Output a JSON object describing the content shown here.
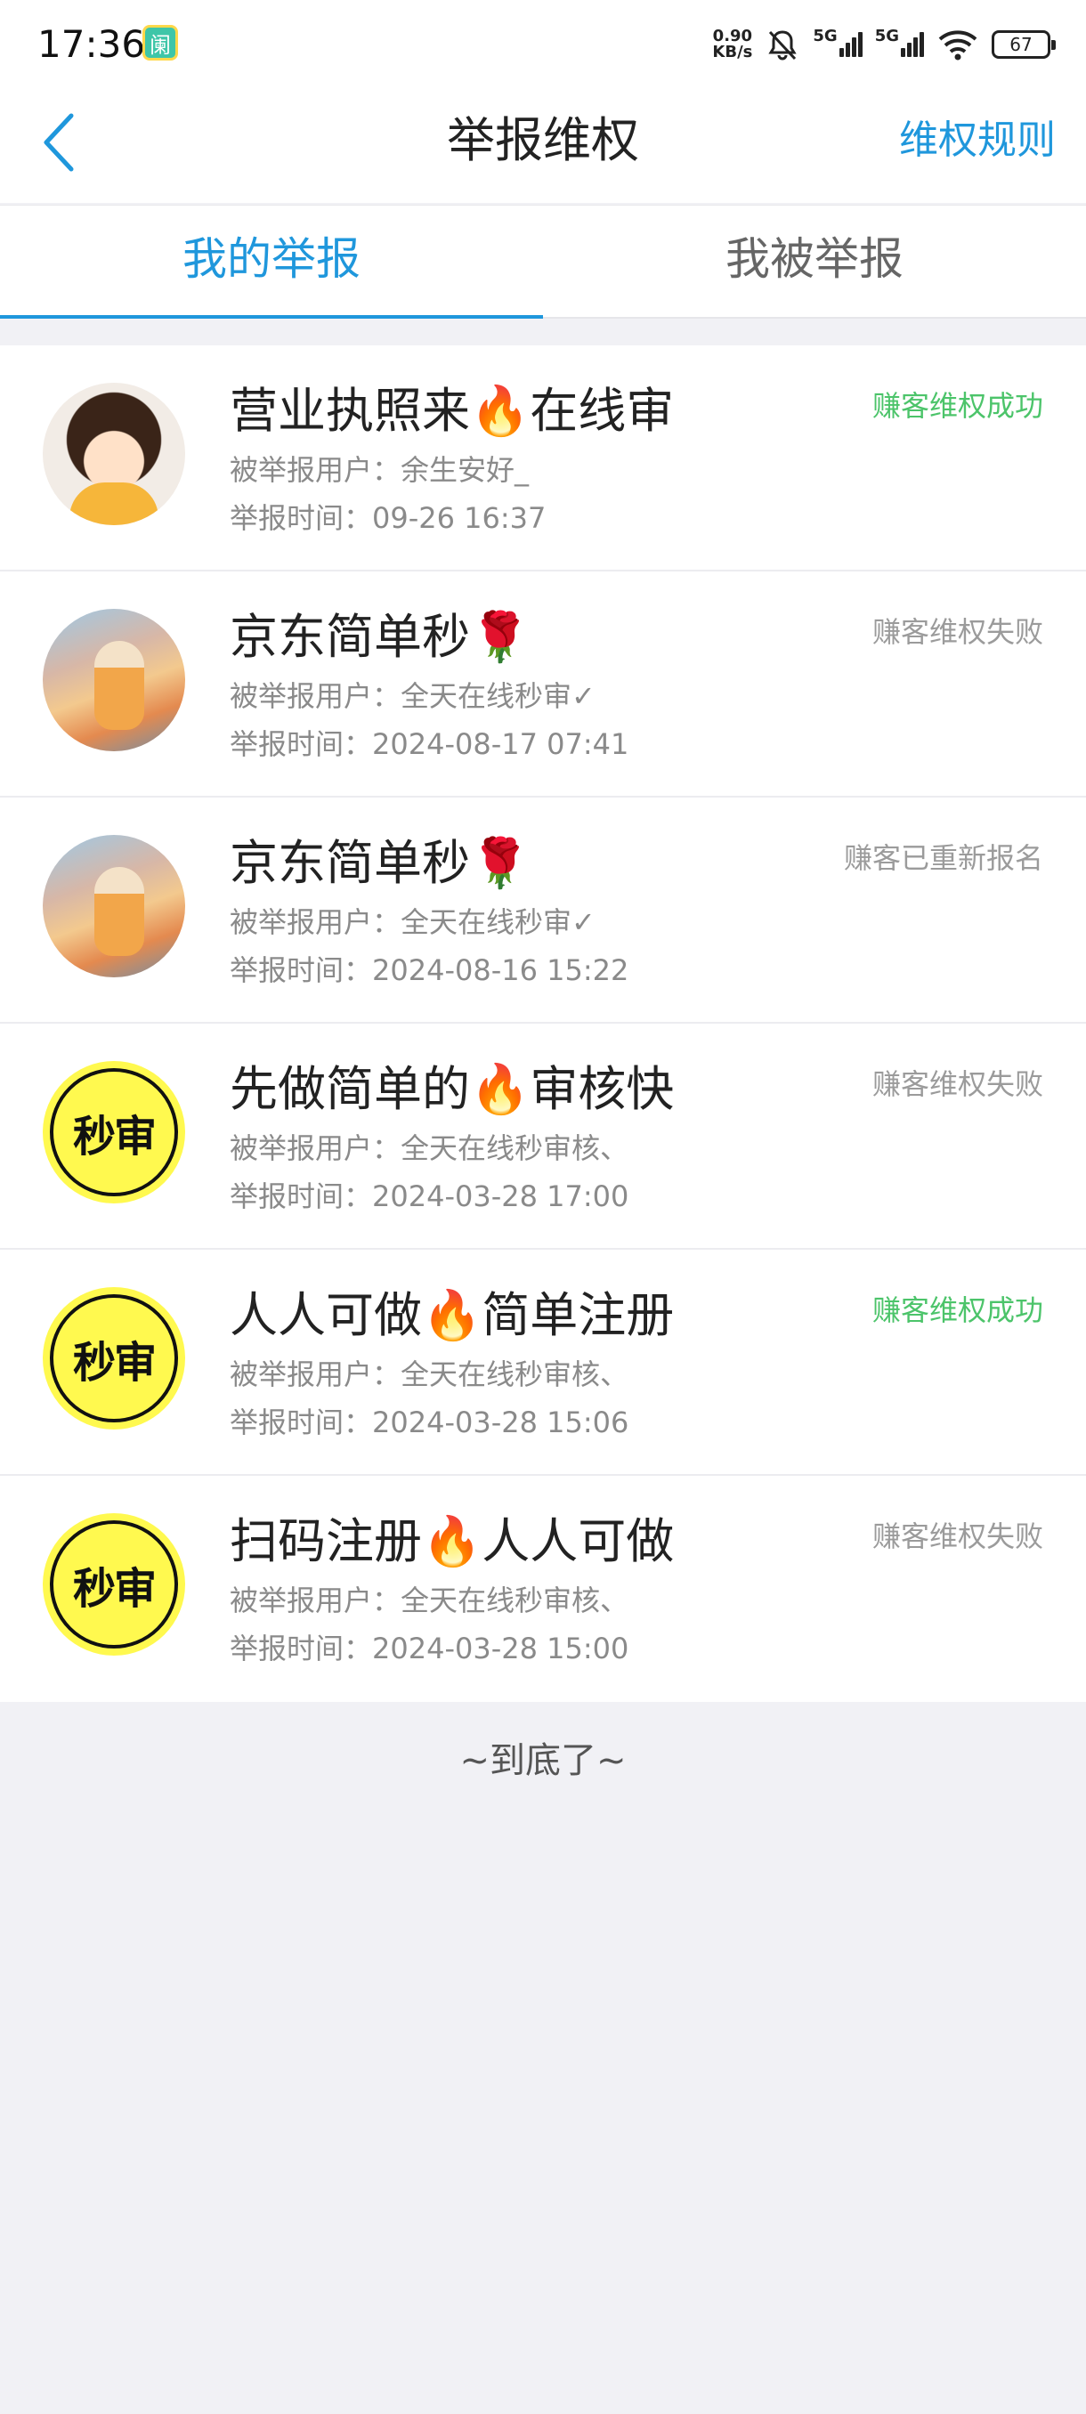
{
  "status_bar": {
    "time": "17:36",
    "app_icon_glyph": "阑",
    "speed_value": "0.90",
    "speed_unit": "KB/s",
    "net_label_1": "5G",
    "net_label_2": "5G",
    "battery": "67",
    "icons": [
      "silent-bell-icon",
      "signal-icon",
      "wifi-icon",
      "battery-icon"
    ]
  },
  "header": {
    "title": "举报维权",
    "right_link": "维权规则",
    "back_icon": "chevron-left-icon"
  },
  "tabs": [
    {
      "label": "我的举报",
      "active": true
    },
    {
      "label": "我被举报",
      "active": false
    }
  ],
  "reports": [
    {
      "avatar": "girl-cartoon",
      "title": "营业执照来🔥在线审",
      "status": "赚客维权成功",
      "status_type": "success",
      "user": "被举报用户：余生安好_",
      "time": "举报时间：09-26 16:37"
    },
    {
      "avatar": "photo",
      "title": "京东简单秒🌹",
      "status": "赚客维权失败",
      "status_type": "fail",
      "user": "被举报用户：全天在线秒审✓",
      "time": "举报时间：2024-08-17 07:41"
    },
    {
      "avatar": "photo",
      "title": "京东简单秒🌹",
      "status": "赚客已重新报名",
      "status_type": "other",
      "user": "被举报用户：全天在线秒审✓",
      "time": "举报时间：2024-08-16 15:22"
    },
    {
      "avatar": "miaoshen",
      "avatar_text": "秒审",
      "title": "先做简单的🔥审核快",
      "status": "赚客维权失败",
      "status_type": "fail",
      "user": "被举报用户：全天在线秒审核、",
      "time": "举报时间：2024-03-28 17:00"
    },
    {
      "avatar": "miaoshen",
      "avatar_text": "秒审",
      "title": "人人可做🔥简单注册",
      "status": "赚客维权成功",
      "status_type": "success",
      "user": "被举报用户：全天在线秒审核、",
      "time": "举报时间：2024-03-28 15:06"
    },
    {
      "avatar": "miaoshen",
      "avatar_text": "秒审",
      "title": "扫码注册🔥人人可做",
      "status": "赚客维权失败",
      "status_type": "fail",
      "user": "被举报用户：全天在线秒审核、",
      "time": "举报时间：2024-03-28 15:00"
    }
  ],
  "footer": {
    "end_note": "~到底了~"
  },
  "colors": {
    "accent": "#1f97dc",
    "success": "#4cc46a",
    "muted": "#9b9b9b",
    "page_bg": "#f1f1f5"
  }
}
